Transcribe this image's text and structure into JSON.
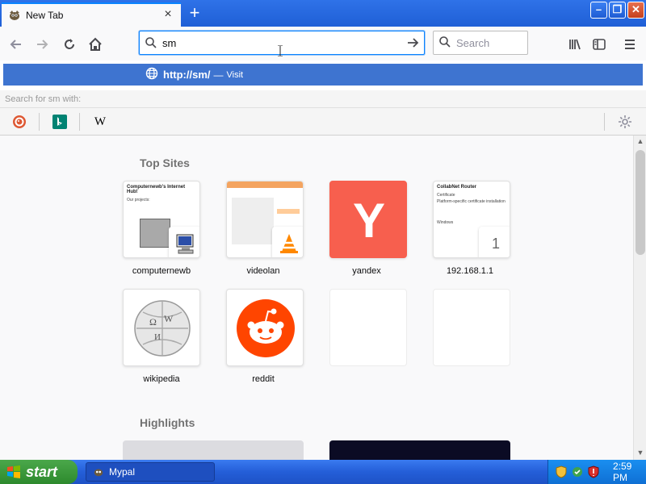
{
  "browser": {
    "tab": {
      "title": "New Tab",
      "close_icon": "close-icon"
    },
    "new_tab_icon": "plus-icon",
    "window_controls": [
      "minimize",
      "maximize",
      "close"
    ]
  },
  "toolbar": {
    "url_value": "sm",
    "search_placeholder": "Search"
  },
  "suggestion": {
    "url": "http://sm/",
    "separator": "—",
    "action": "Visit"
  },
  "search_with": "Search for sm with:",
  "engines": [
    "duckduckgo",
    "bing",
    "wikipedia"
  ],
  "engine_labels": {
    "wikipedia": "W"
  },
  "newtab": {
    "top_sites_title": "Top Sites",
    "highlights_title": "Highlights",
    "top_sites": [
      {
        "label": "computernewb"
      },
      {
        "label": "videolan"
      },
      {
        "label": "yandex"
      },
      {
        "label": "192.168.1.1",
        "badge": "1"
      },
      {
        "label": "wikipedia"
      },
      {
        "label": "reddit"
      },
      {
        "label": ""
      },
      {
        "label": ""
      }
    ],
    "thumb_texts": {
      "computernewb": "Computernewb's Internet Hub!",
      "computernewb_sub": "Our projects:",
      "router": "CollabNet Router",
      "router_sub": "Certificate",
      "router_sub2": "Platform-specific certificate installation",
      "router_sub3": "Windows"
    },
    "yandex_letter": "Y"
  },
  "taskbar": {
    "start_label": "start",
    "task": "Mypal",
    "clock": "2:59 PM"
  },
  "colors": {
    "accent": "#0a84ff",
    "suggest_bg": "#3e74d0",
    "titlebar": "#245ed8",
    "yandex": "#f75f4e",
    "reddit": "#ff4500",
    "vlc": "#ff8800",
    "start_green": "#2d8a2d"
  }
}
